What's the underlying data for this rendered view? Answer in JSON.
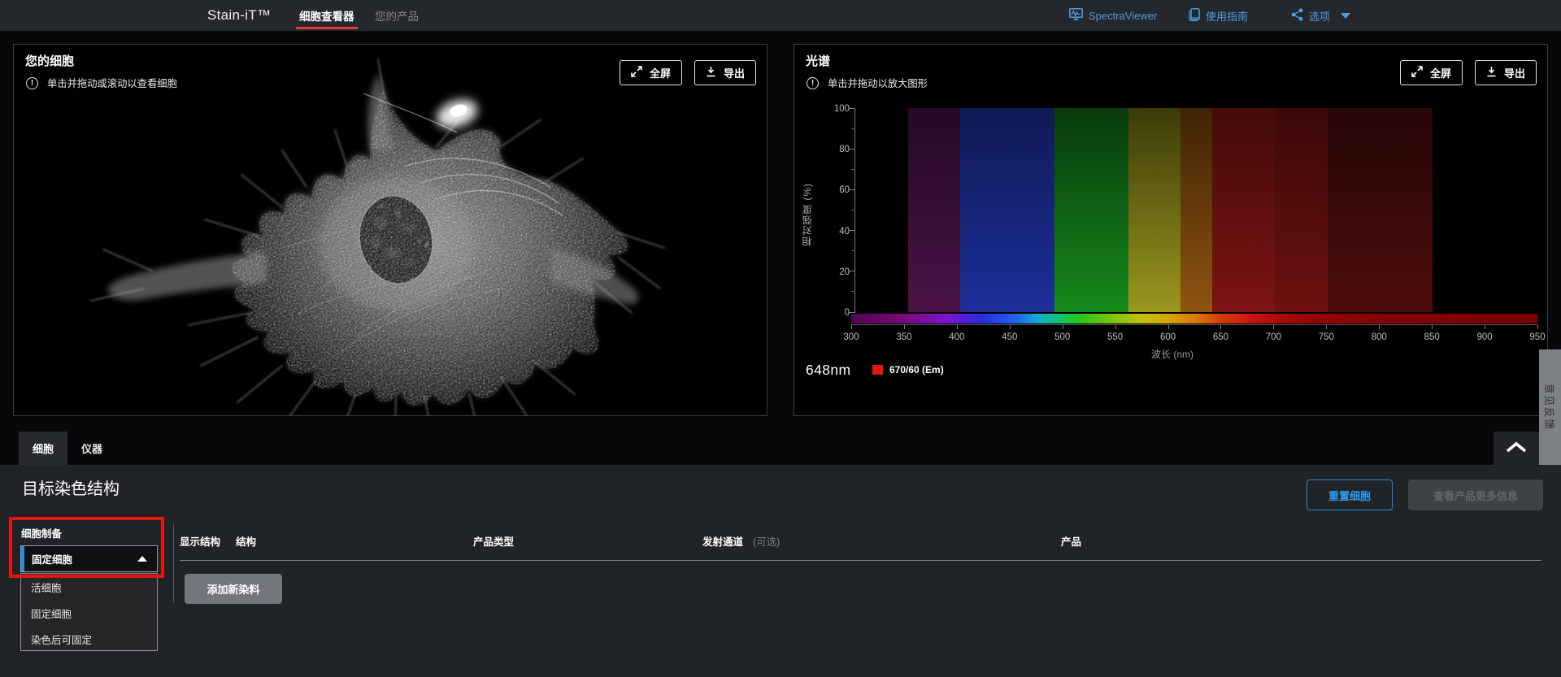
{
  "nav": {
    "brand": "Stain-iT™",
    "tabs": [
      {
        "label": "细胞查看器",
        "active": true
      },
      {
        "label": "您的产品",
        "active": false
      }
    ],
    "links": [
      {
        "label": "SpectraViewer",
        "icon": "spectra-monitor-icon"
      },
      {
        "label": "使用指南",
        "icon": "guide-book-icon"
      },
      {
        "label": "选项",
        "icon": "share-icon",
        "has_dropdown": true
      }
    ],
    "accent_red": "#e23c35",
    "link_blue": "#4e9ee0"
  },
  "cell_panel": {
    "title": "您的细胞",
    "hint": "单击并拖动或滚动以查看细胞",
    "fullscreen_label": "全屏",
    "export_label": "导出"
  },
  "spectra_panel": {
    "title": "光谱",
    "hint": "单击并拖动以放大图形",
    "fullscreen_label": "全屏",
    "export_label": "导出"
  },
  "chart_data": {
    "type": "area",
    "title": "光谱",
    "xlabel": "波长 (nm)",
    "ylabel": "相对强度 (%)",
    "xlim": [
      300,
      950
    ],
    "ylim": [
      0,
      100
    ],
    "x_ticks": [
      300,
      350,
      400,
      450,
      500,
      550,
      600,
      650,
      700,
      750,
      800,
      850,
      900,
      950
    ],
    "y_ticks": [
      0,
      20,
      40,
      60,
      80,
      100
    ],
    "grid": false,
    "legend_position": "bottom-left",
    "excitation_nm": "648nm",
    "legend": [
      {
        "label": "670/60 (Em)",
        "color": "#e81414"
      }
    ],
    "filter_bands": [
      {
        "from_nm": 350,
        "to_nm": 400,
        "value_pct": 100,
        "color_top": "#250926",
        "color_bottom": "#4a1347"
      },
      {
        "from_nm": 400,
        "to_nm": 490,
        "value_pct": 100,
        "color_top": "#101a55",
        "color_bottom": "#1d2f9a"
      },
      {
        "from_nm": 490,
        "to_nm": 560,
        "value_pct": 100,
        "color_top": "#093a0d",
        "color_bottom": "#168a1b"
      },
      {
        "from_nm": 560,
        "to_nm": 610,
        "value_pct": 100,
        "color_top": "#3c3a08",
        "color_bottom": "#9a981e"
      },
      {
        "from_nm": 610,
        "to_nm": 640,
        "value_pct": 100,
        "color_top": "#3f2305",
        "color_bottom": "#8f5410"
      },
      {
        "from_nm": 640,
        "to_nm": 700,
        "value_pct": 100,
        "color_top": "#430b0b",
        "color_bottom": "#7d1414"
      },
      {
        "from_nm": 700,
        "to_nm": 750,
        "value_pct": 100,
        "color_top": "#3b0909",
        "color_bottom": "#6e1111"
      },
      {
        "from_nm": 750,
        "to_nm": 850,
        "value_pct": 100,
        "color_top": "#260606",
        "color_bottom": "#4e0d0d"
      }
    ],
    "spectrum_bar_stops": [
      [
        0,
        "#4f064e"
      ],
      [
        8,
        "#7c0a7c"
      ],
      [
        14,
        "#7a15d2"
      ],
      [
        19,
        "#2b2be0"
      ],
      [
        24,
        "#1f63e8"
      ],
      [
        27,
        "#14a8d8"
      ],
      [
        30,
        "#12c27a"
      ],
      [
        33,
        "#22c816"
      ],
      [
        38,
        "#7ac410"
      ],
      [
        42,
        "#bcc20c"
      ],
      [
        46,
        "#d9a50a"
      ],
      [
        50,
        "#d97b08"
      ],
      [
        54,
        "#d33c0a"
      ],
      [
        58,
        "#cf1410"
      ],
      [
        62,
        "#ae0a0a"
      ],
      [
        68,
        "#930505"
      ],
      [
        80,
        "#840303"
      ],
      [
        100,
        "#7c0202"
      ]
    ]
  },
  "tabs_bar": {
    "tabs": [
      {
        "label": "细胞",
        "active": true
      },
      {
        "label": "仪器",
        "active": false
      }
    ]
  },
  "feedback_tab": {
    "label": "意见反馈"
  },
  "staining": {
    "heading": "目标染色结构",
    "reset_button": "重置细胞",
    "more_info_button": "查看产品更多信息",
    "cell_prep_label": "细胞制备",
    "dropdown": {
      "value": "固定细胞",
      "expanded": true,
      "options": [
        "活细胞",
        "固定细胞",
        "染色后可固定"
      ]
    },
    "table_headers": [
      "显示结构",
      "结构",
      "产品类型",
      "发射通道",
      "(可选)",
      "产品"
    ],
    "add_dye_button": "添加新染料"
  }
}
